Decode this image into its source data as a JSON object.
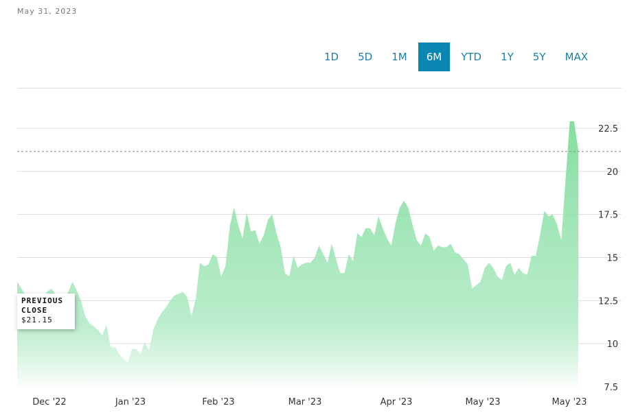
{
  "as_of_date": "May 31, 2023",
  "range_selector": {
    "buttons": [
      "1D",
      "5D",
      "1M",
      "6M",
      "YTD",
      "1Y",
      "5Y",
      "MAX"
    ],
    "active": "6M"
  },
  "tooltip": {
    "title": "PREVIOUS CLOSE",
    "value": "$21.15"
  },
  "colors": {
    "accent": "#0a86b3",
    "fill_top": "#7fdc9a",
    "fill_bottom": "#ffffff",
    "grid": "#dcdcdc",
    "reference_line": "#888888"
  },
  "chart_data": {
    "type": "area",
    "title": "",
    "xlabel": "",
    "ylabel": "",
    "x_tick_labels": [
      "Dec '22",
      "Jan '23",
      "Feb '23",
      "Mar '23",
      "Apr '23",
      "May '23",
      "May '23"
    ],
    "y_ticks": [
      7.5,
      10,
      12.5,
      15,
      17.5,
      20,
      22.5
    ],
    "ylim": [
      7.5,
      23.5
    ],
    "grid": true,
    "reference_line": {
      "label": "PREVIOUS CLOSE",
      "value": 21.15,
      "style": "dashed"
    },
    "series": [
      {
        "values": [
          13.6,
          13.2,
          12.8,
          12.3,
          12.8,
          12.5,
          12.6,
          13.0,
          13.2,
          12.9,
          12.3,
          12.6,
          13.0,
          13.6,
          13.1,
          12.5,
          11.6,
          11.2,
          11.0,
          10.8,
          10.5,
          11.1,
          9.8,
          9.8,
          9.4,
          9.1,
          8.9,
          9.7,
          9.7,
          9.4,
          10.1,
          9.6,
          10.8,
          11.4,
          11.8,
          12.1,
          12.5,
          12.8,
          12.9,
          13.0,
          12.7,
          11.6,
          12.6,
          14.7,
          14.5,
          14.6,
          15.2,
          15.0,
          13.9,
          14.5,
          16.8,
          17.9,
          16.9,
          16.1,
          17.6,
          16.5,
          16.6,
          15.8,
          16.3,
          17.2,
          17.5,
          16.4,
          15.6,
          14.1,
          13.9,
          15.1,
          14.4,
          14.6,
          14.7,
          14.7,
          15.0,
          15.7,
          15.2,
          14.7,
          15.8,
          14.9,
          14.1,
          14.1,
          15.2,
          14.8,
          16.4,
          16.2,
          16.7,
          16.7,
          16.3,
          17.4,
          16.7,
          16.1,
          15.7,
          17.0,
          17.9,
          18.3,
          17.9,
          16.9,
          16.0,
          15.7,
          16.4,
          16.2,
          15.4,
          15.7,
          15.6,
          15.6,
          15.8,
          15.3,
          15.2,
          14.9,
          14.6,
          13.2,
          13.4,
          13.6,
          14.4,
          14.7,
          14.4,
          13.9,
          13.7,
          14.5,
          14.7,
          14.0,
          14.4,
          14.1,
          14.0,
          15.1,
          15.1,
          16.3,
          17.7,
          17.4,
          17.5,
          16.9,
          16.0,
          19.5,
          22.9,
          22.9,
          21.2
        ]
      }
    ]
  }
}
